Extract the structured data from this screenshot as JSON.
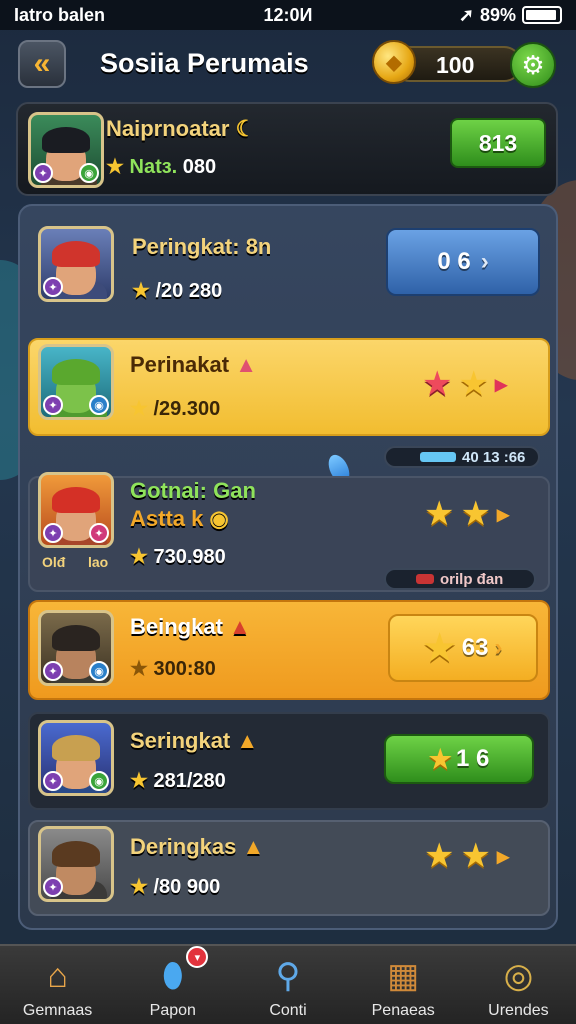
{
  "status_bar": {
    "carrier": "Iatro balen",
    "time": "12:0И",
    "battery": "89%"
  },
  "header": {
    "title": "Sosiia Perumais",
    "coins": "100",
    "back_icon": "chevron-left-icon",
    "settings_icon": "gear-icon"
  },
  "player": {
    "name": "Naiprnoatar",
    "stat_label": "Natз.",
    "stat_value": "080",
    "score": "813"
  },
  "rows": [
    {
      "name": "Peringkat: 8n",
      "score": "/20 280",
      "button": "0 6"
    },
    {
      "name": "Perinakat",
      "score": "/29.300"
    },
    {
      "name": "Gotnai: Gan",
      "subname": "Astta k",
      "score": "730.980",
      "badge_left": "Olđ",
      "badge_right": "lao"
    },
    {
      "name": "Beingkat",
      "score": "300:80",
      "button": "63"
    },
    {
      "name": "Seringkat",
      "score": "281/280",
      "button": "1 6"
    },
    {
      "name": "Deringkas",
      "score": "/80 900"
    }
  ],
  "progress_pills": {
    "top": "40 13 :66",
    "bottom": "orilp đan",
    "top_fraction": 0.45
  },
  "nav": [
    {
      "label": "Gemnaas",
      "icon": "home-icon"
    },
    {
      "label": "Papon",
      "icon": "shield-icon"
    },
    {
      "label": "Conti",
      "icon": "magnifier-icon"
    },
    {
      "label": "Penaeas",
      "icon": "calendar-icon"
    },
    {
      "label": "Urendes",
      "icon": "chevron-coin-icon"
    }
  ],
  "colors": {
    "accent_gold": "#f7c531",
    "accent_green": "#4cb52e",
    "accent_blue": "#3f7cc8",
    "highlight_row": "#f6ca45",
    "orange_row": "#f3a629"
  }
}
